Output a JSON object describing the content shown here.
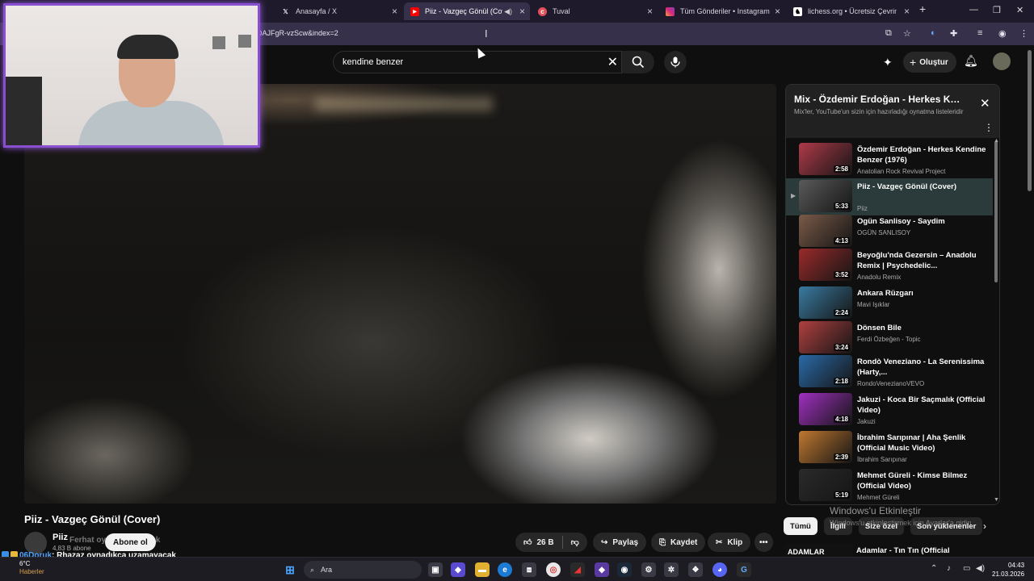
{
  "browser": {
    "tabs": [
      {
        "label": "Anasayfa / X",
        "icon": "x-logo-icon",
        "active": false
      },
      {
        "label": "Piiz - Vazgeç Gönül (Cover)",
        "icon": "youtube-icon",
        "active": true
      },
      {
        "label": "Tuval",
        "icon": "canva-icon",
        "active": false
      },
      {
        "label": "Tüm Gönderiler • Instagram",
        "icon": "instagram-icon",
        "active": false
      },
      {
        "label": "lichess.org • Ücretsiz Çevrimiçi",
        "icon": "lichess-icon",
        "active": false
      }
    ],
    "new_tab_symbol": "+",
    "url": "DAJFgR-vzScw&index=2"
  },
  "youtube": {
    "search_query": "kendine benzer",
    "create_label": "Oluştur",
    "video_title": "Piiz - Vazgeç Gönül (Cover)",
    "channel_name": "Piiz",
    "subscribers": "4,83 B abone",
    "subscribe_label": "Abone ol",
    "likes": "26 B",
    "share_label": "Paylaş",
    "save_label": "Kaydet",
    "clip_label": "Klip",
    "more_symbol": "•••"
  },
  "overlay_chat": {
    "ghost_line": "Ferhat oyna... uzayacak",
    "user": "06Doruk",
    "message": ": Rhazaz oynadıkça uzamayacak",
    "extra": "Rhazaz"
  },
  "mix_panel": {
    "title": "Mix - Özdemir Erdoğan - Herkes Kendine Benzer",
    "subtitle": "Mix'ler, YouTube'un sizin için hazırladığı oynatma listeleridir",
    "items": [
      {
        "title": "Özdemir Erdoğan - Herkes Kendine Benzer (1976)",
        "channel": "Anatolian Rock Revival Project",
        "duration": "2:58",
        "thumb_color": "#b03a4a",
        "current": false
      },
      {
        "title": "Piiz - Vazgeç Gönül (Cover)",
        "channel": "Piiz",
        "duration": "5:33",
        "thumb_color": "#5a5a5a",
        "current": true
      },
      {
        "title": "Ogün Sanlisoy - Saydim",
        "channel": "OGÜN SANLISOY",
        "duration": "4:13",
        "thumb_color": "#7a5a48",
        "current": false
      },
      {
        "title": "Beyoğlu'nda Gezersin – Anadolu Remix | Psychedelic...",
        "channel": "Anadolu Remix",
        "duration": "3:52",
        "thumb_color": "#9a2a2a",
        "current": false
      },
      {
        "title": "Ankara Rüzgarı",
        "channel": "Mavi Işıklar",
        "duration": "2:24",
        "thumb_color": "#3a7aa0",
        "current": false
      },
      {
        "title": "Dönsen Bile",
        "channel": "Ferdi Özbeğen - Topic",
        "duration": "3:24",
        "thumb_color": "#b04040",
        "current": false
      },
      {
        "title": "Rondò Veneziano - La Serenissima (Harty,...",
        "channel": "RondoVenezianoVEVO",
        "duration": "2:18",
        "thumb_color": "#2a6aa8",
        "current": false
      },
      {
        "title": "Jakuzi - Koca Bir Saçmalık (Official Video)",
        "channel": "Jakuzi",
        "duration": "4:18",
        "thumb_color": "#a030c0",
        "current": false
      },
      {
        "title": "İbrahim Sarıpınar | Aha Şenlik (Official Music Video)",
        "channel": "İbrahim Sarıpınar",
        "duration": "2:39",
        "thumb_color": "#c07830",
        "current": false
      },
      {
        "title": "Mehmet Güreli - Kimse Bilmez (Official Video)",
        "channel": "Mehmet Güreli",
        "duration": "5:19",
        "thumb_color": "#2a2a2a",
        "current": false
      }
    ]
  },
  "chips": [
    "Tümü",
    "İlgili",
    "Size özel",
    "Son yüklenenler"
  ],
  "windows_activation": {
    "title": "Windows'u Etkinleştir",
    "subtitle": "Windows'u etkinleştirmek için Ayarlar'a gidin"
  },
  "next_video": {
    "thumb_text": "ADAMLAR",
    "title": "Adamlar - Tın Tın (Official"
  },
  "taskbar": {
    "search_label": "Ara",
    "temperature": "6°C",
    "weather_text": "Haberler",
    "time": "04:43",
    "date": "21.03.2026"
  }
}
